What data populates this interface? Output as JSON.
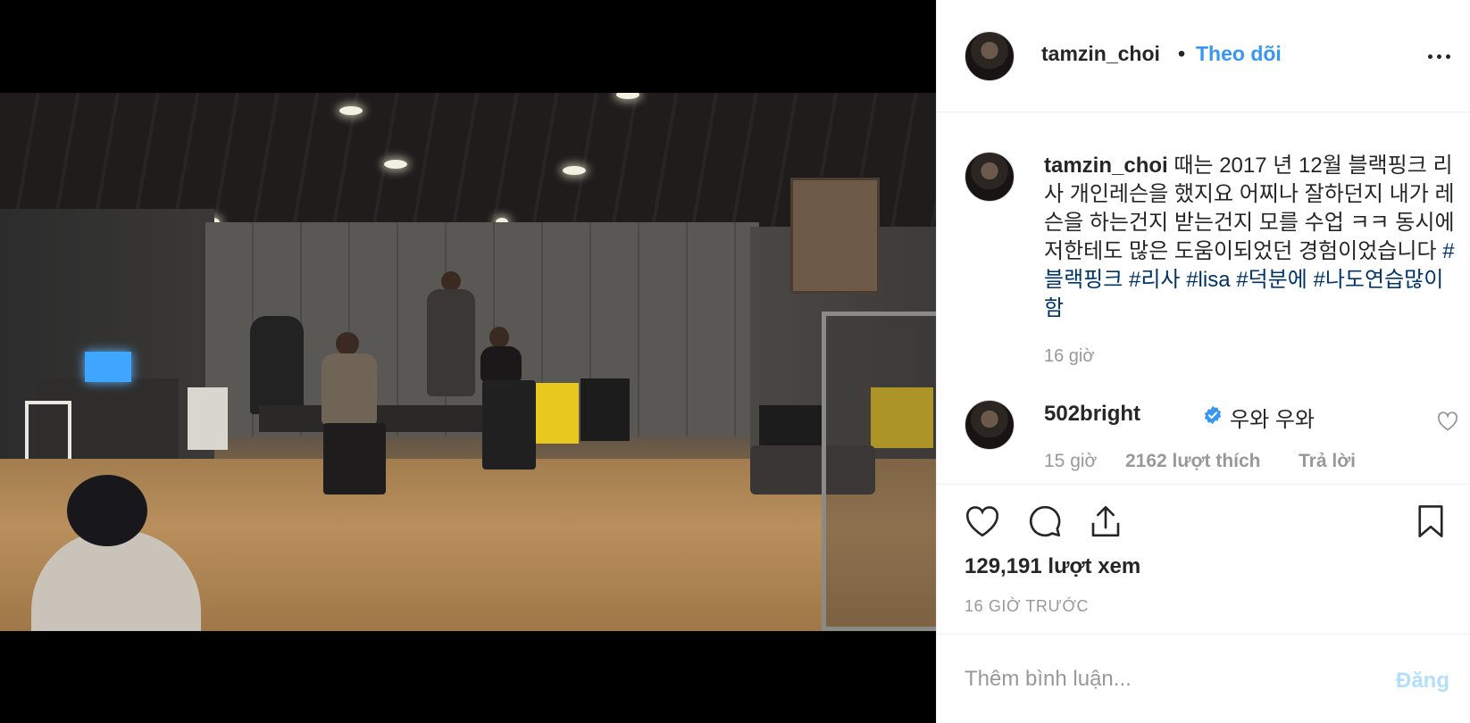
{
  "post": {
    "username": "tamzin_choi",
    "separator": "•",
    "follow_label": "Theo dõi",
    "more_icon": "more-horizontal-icon"
  },
  "caption": {
    "username": "tamzin_choi",
    "text": "때는 2017 년 12월 블랙핑크 리사 개인레슨을 했지요 어찌나 잘하던지 내가 레슨을 하는건지 받는건지 모를 수업 ㅋㅋ 동시에 저한테도 많은 도움이되었던 경험이었습니다",
    "hashtags": [
      "#블랙핑크",
      "#리사",
      "#lisa",
      "#덕분에",
      "#나도연습많이함"
    ],
    "time": "16 giờ"
  },
  "comment": {
    "username": "502bright",
    "verified_icon": "verified-badge-icon",
    "text": "우와 우와",
    "time": "15 giờ",
    "likes": "2162 lượt thích",
    "reply_label": "Trả lời",
    "like_icon": "heart-outline-icon"
  },
  "actions": {
    "like_icon": "heart-icon",
    "comment_icon": "comment-bubble-icon",
    "share_icon": "share-upload-icon",
    "save_icon": "bookmark-icon",
    "views": "129,191 lượt xem",
    "posted_ago": "16 GIỜ TRƯỚC"
  },
  "add_comment": {
    "placeholder": "Thêm bình luận...",
    "post_label": "Đăng"
  },
  "colors": {
    "link_blue": "#3897f0",
    "hashtag": "#003569",
    "muted": "#999999",
    "post_disabled": "#b2dffc"
  }
}
